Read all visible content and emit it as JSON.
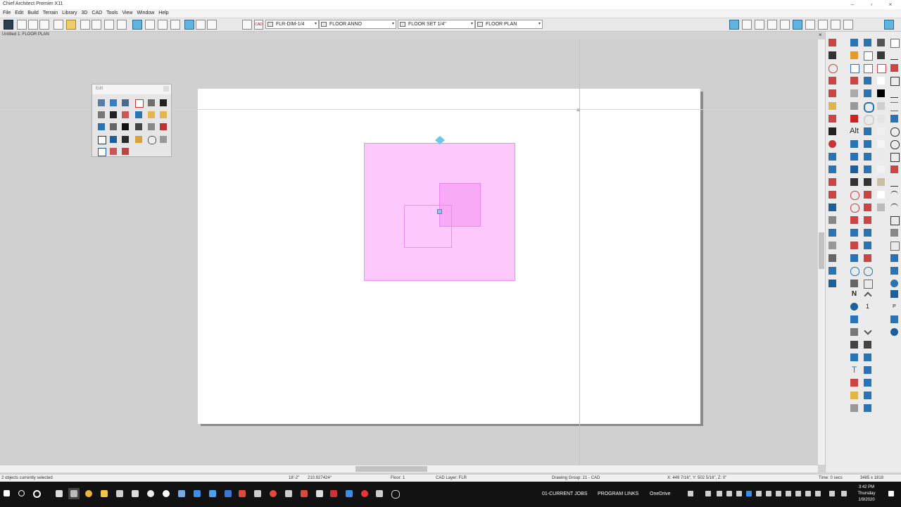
{
  "window": {
    "title": "Chief Architect Premier X11"
  },
  "menu": [
    "File",
    "Edit",
    "Build",
    "Terrain",
    "Library",
    "3D",
    "CAD",
    "Tools",
    "View",
    "Window",
    "Help"
  ],
  "toolbar": {
    "dropdowns": [
      {
        "label": "FLR-DIM-1/4"
      },
      {
        "label": "FLOOR ANNO"
      },
      {
        "label": "FLOOR SET 1/4\""
      },
      {
        "label": "FLOOR PLAN"
      }
    ],
    "cad_badge": "CAD"
  },
  "document_tab": {
    "label": "Untitled 1: FLOOR PLAN",
    "close": "×"
  },
  "edit_palette": {
    "title": "Edit"
  },
  "status": {
    "selection": "2 objects currently selected",
    "length": "18'-2\"",
    "angle": "210.927424°",
    "floor": "Floor: 1",
    "cad_layer": "CAD Layer:    FLR",
    "drawing_group": "Drawing Group: 21 - CAD",
    "coords": "X: 449 7/16\", Y: 502 5/16\", Z: 0\"",
    "time": "Time: 0 secs",
    "resolution": "3485 x 1818"
  },
  "right_panel_text": {
    "alt_label": "Alt",
    "n_label": "N",
    "one_label": "1",
    "t_label": "T",
    "p_label": "P"
  },
  "taskbar": {
    "items": [
      "01-CURRENT JOBS",
      "PROGRAM LINKS",
      "OneDrive"
    ],
    "clock": {
      "time": "3:42 PM",
      "day": "Thursday",
      "date": "1/9/2020"
    }
  },
  "colors": {
    "selection_fill": "#fdc8fc",
    "selection_overlap": "#f9a9f6",
    "handle": "#7fc8f0",
    "guide": "#a9d7a5"
  }
}
